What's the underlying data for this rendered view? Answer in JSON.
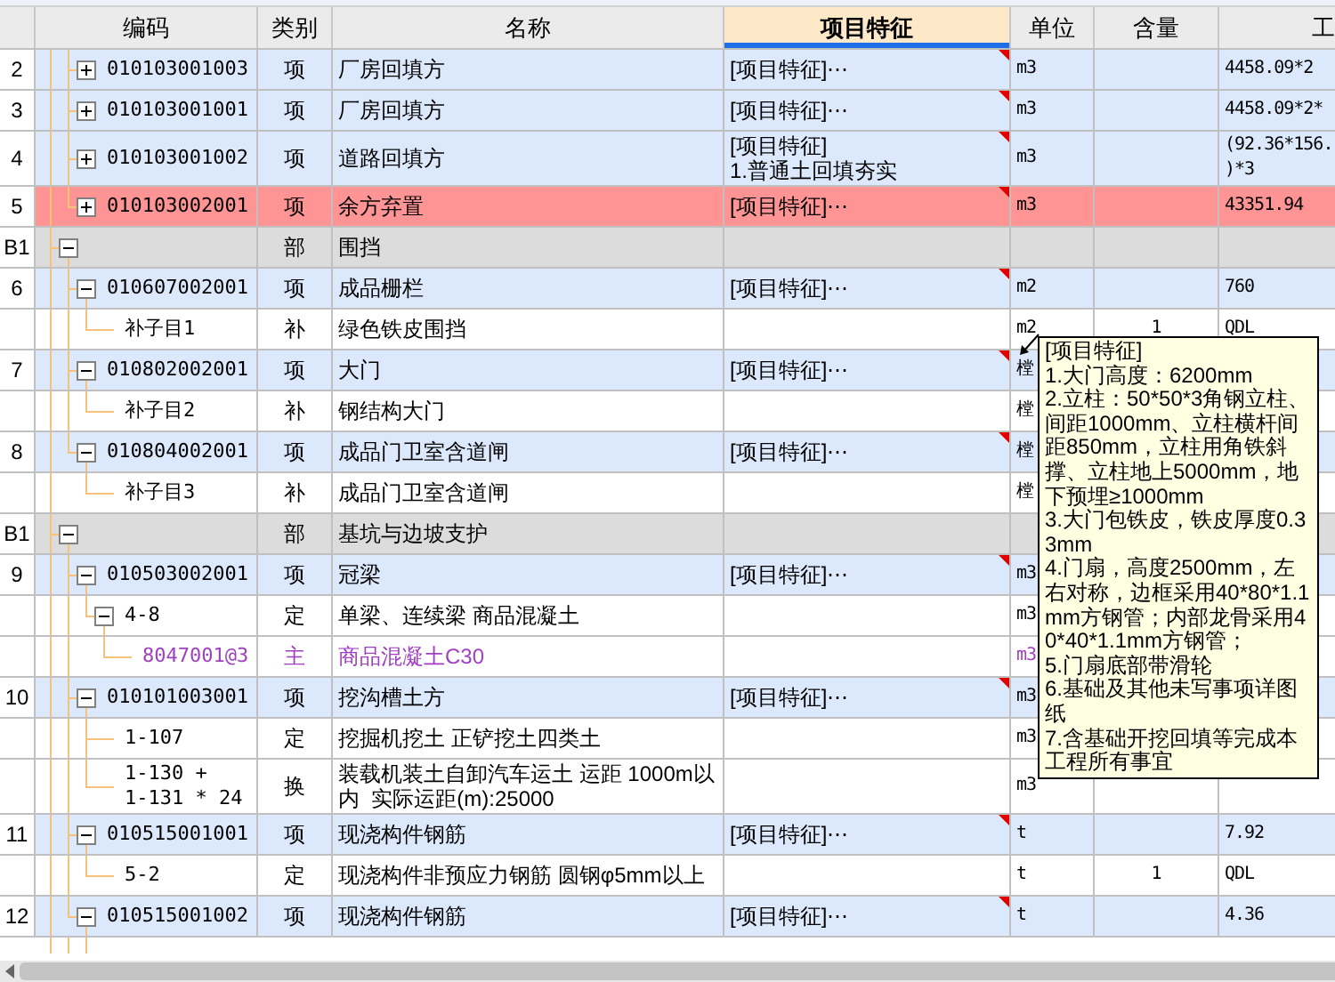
{
  "columns": [
    {
      "label": "编码",
      "selected": false
    },
    {
      "label": "类别",
      "selected": false
    },
    {
      "label": "名称",
      "selected": false
    },
    {
      "label": "项目特征",
      "selected": true
    },
    {
      "label": "单位",
      "selected": false
    },
    {
      "label": "含量",
      "selected": false
    },
    {
      "label": "工",
      "selected": false
    }
  ],
  "groups": [
    {
      "children": [
        {
          "number": "2",
          "kind": "item",
          "code": "010103001003",
          "type": "项",
          "name": "厂房回填方",
          "feature": "[项目特征]⋯",
          "unit": "m3",
          "expression": "4458.09*2",
          "expanded": false,
          "selected": false
        },
        {
          "number": "3",
          "kind": "item",
          "code": "010103001001",
          "type": "项",
          "name": "厂房回填方",
          "feature": "[项目特征]⋯",
          "unit": "m3",
          "expression": "4458.09*2*",
          "expanded": false,
          "selected": false
        },
        {
          "number": "4",
          "kind": "item",
          "code": "010103001002",
          "type": "项",
          "name": "道路回填方",
          "feature": "[项目特征]\n1.普通土回填夯实",
          "unit": "m3",
          "expression": "(92.36*156.\n)*3",
          "expanded": false,
          "selected": false
        },
        {
          "number": "5",
          "kind": "item",
          "code": "010103002001",
          "type": "项",
          "name": "余方弃置",
          "feature": "[项目特征]⋯",
          "unit": "m3",
          "expression": "43351.94",
          "expanded": false,
          "selected": true
        }
      ]
    },
    {
      "header": {
        "number": "B1",
        "kind": "section",
        "type": "部",
        "name": "围挡",
        "expanded": true,
        "selected": false
      },
      "children": [
        {
          "number": "6",
          "kind": "item",
          "code": "010607002001",
          "type": "项",
          "name": "成品栅栏",
          "feature": "[项目特征]⋯",
          "unit": "m2",
          "expression": "760",
          "expanded": true,
          "selected": false,
          "children": [
            {
              "kind": "sub",
              "code": "补子目1",
              "type": "补",
              "name": "绿色铁皮围挡",
              "unit": "m2",
              "quantity": "1",
              "expression": "QDL",
              "selected": false
            }
          ]
        },
        {
          "number": "7",
          "kind": "item",
          "code": "010802002001",
          "type": "项",
          "name": "大门",
          "feature": "[项目特征]⋯",
          "unit": "樘",
          "expanded": true,
          "selected": false,
          "children": [
            {
              "kind": "sub",
              "code": "补子目2",
              "type": "补",
              "name": "钢结构大门",
              "unit": "樘",
              "selected": false
            }
          ]
        },
        {
          "number": "8",
          "kind": "item",
          "code": "010804002001",
          "type": "项",
          "name": "成品门卫室含道闸",
          "feature": "[项目特征]⋯",
          "unit": "樘",
          "expanded": true,
          "selected": false,
          "children": [
            {
              "kind": "sub",
              "code": "补子目3",
              "type": "补",
              "name": "成品门卫室含道闸",
              "unit": "樘",
              "selected": false
            }
          ]
        }
      ]
    },
    {
      "header": {
        "number": "B1",
        "kind": "section",
        "type": "部",
        "name": "基坑与边坡支护",
        "expanded": true,
        "selected": false
      },
      "children": [
        {
          "number": "9",
          "kind": "item",
          "code": "010503002001",
          "type": "项",
          "name": "冠梁",
          "feature": "[项目特征]⋯",
          "unit": "m3",
          "expanded": true,
          "selected": false,
          "children": [
            {
              "kind": "sub",
              "code": "4-8",
              "type": "定",
              "name": "单梁、连续梁 商品混凝土",
              "unit": "m3",
              "expanded": true,
              "selected": false,
              "children": [
                {
                  "kind": "material",
                  "code": "8047001@3",
                  "type": "主",
                  "name": "商品混凝土C30",
                  "unit": "m3",
                  "selected": false
                }
              ]
            }
          ]
        },
        {
          "number": "10",
          "kind": "item",
          "code": "010101003001",
          "type": "项",
          "name": "挖沟槽土方",
          "feature": "[项目特征]⋯",
          "unit": "m3",
          "expanded": true,
          "selected": false,
          "children": [
            {
              "kind": "sub",
              "code": "1-107",
              "type": "定",
              "name": "挖掘机挖土 正铲挖土四类土",
              "unit": "m3",
              "selected": false
            },
            {
              "kind": "conversion",
              "code": "1-130 +\n1-131 * 24",
              "type": "换",
              "name": "装载机装土自卸汽车运土 运距 1000m以内  实际运距(m):25000",
              "unit": "m3",
              "selected": false
            }
          ]
        },
        {
          "number": "11",
          "kind": "item",
          "code": "010515001001",
          "type": "项",
          "name": "现浇构件钢筋",
          "feature": "[项目特征]⋯",
          "unit": "t",
          "expression": "7.92",
          "expanded": true,
          "selected": false,
          "children": [
            {
              "kind": "sub",
              "code": "5-2",
              "type": "定",
              "name": "现浇构件非预应力钢筋 圆钢φ5mm以上",
              "unit": "t",
              "quantity": "1",
              "expression": "QDL",
              "selected": false
            }
          ]
        },
        {
          "number": "12",
          "kind": "item",
          "code": "010515001002",
          "type": "项",
          "name": "现浇构件钢筋",
          "feature": "[项目特征]⋯",
          "unit": "t",
          "expression": "4.36",
          "expanded": true,
          "selected": false
        }
      ]
    }
  ],
  "tooltip": {
    "lines": [
      "[项目特征]",
      "1.大门高度：6200mm",
      "2.立柱：50*50*3角钢立柱、间距1000mm、立柱横杆间距850mm，立柱用角铁斜撑、立柱地上5000mm，地下预埋≥1000mm",
      "3.大门包铁皮，铁皮厚度0.33mm",
      "4.门扇，高度2500mm，左右对称，边框采用40*80*1.1mm方钢管；内部龙骨采用40*40*1.1mm方钢管；",
      "5.门扇底部带滑轮",
      "6.基础及其他未写事项详图纸",
      "7.含基础开挖回填等完成本工程所有事宜"
    ]
  }
}
